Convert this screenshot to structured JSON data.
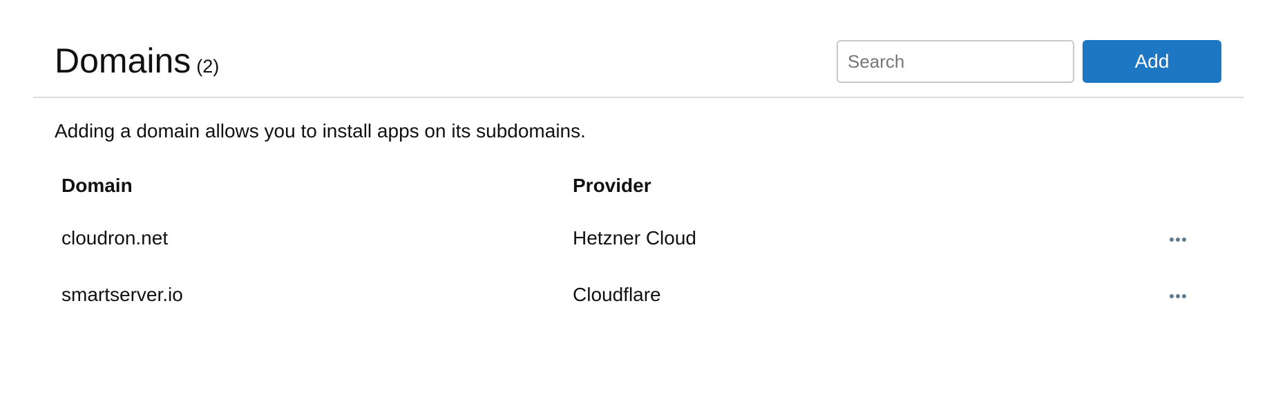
{
  "header": {
    "title": "Domains",
    "count": "(2)",
    "search_placeholder": "Search",
    "add_label": "Add"
  },
  "description": "Adding a domain allows you to install apps on its subdomains.",
  "table": {
    "columns": {
      "domain": "Domain",
      "provider": "Provider"
    },
    "rows": [
      {
        "domain": "cloudron.net",
        "provider": "Hetzner Cloud",
        "actions_icon": "more-horizontal-icon"
      },
      {
        "domain": "smartserver.io",
        "provider": "Cloudflare",
        "actions_icon": "more-horizontal-icon"
      }
    ]
  },
  "colors": {
    "accent": "#1e77c2",
    "icon": "#5d7a8c",
    "divider": "#dcdcdc"
  }
}
